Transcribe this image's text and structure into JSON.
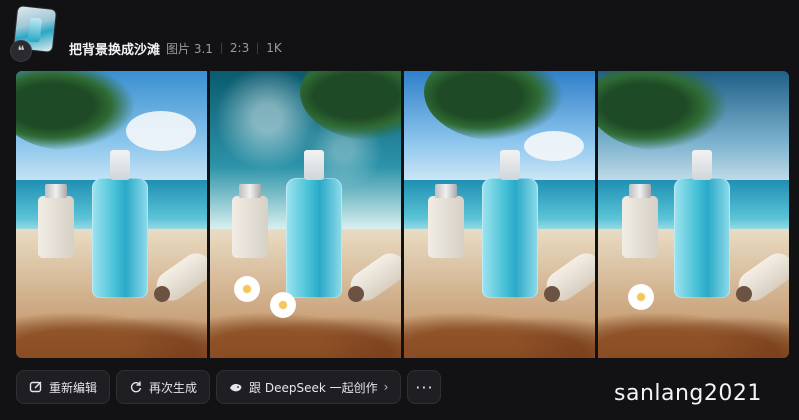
{
  "header": {
    "title": "把背景换成沙滩",
    "model": "图片 3.1",
    "ratio": "2:3",
    "resolution": "1K",
    "quote_icon": "quote-icon"
  },
  "images": [
    {
      "alt": "beach-product-1"
    },
    {
      "alt": "beach-product-2"
    },
    {
      "alt": "beach-product-3"
    },
    {
      "alt": "beach-product-4"
    }
  ],
  "actions": {
    "edit_label": "重新编辑",
    "regenerate_label": "再次生成",
    "deepseek_label": "跟 DeepSeek 一起创作",
    "more_label": "···",
    "edit_icon": "edit-icon",
    "regenerate_icon": "refresh-icon",
    "deepseek_icon": "deepseek-whale-icon"
  },
  "watermark": "sanlang2021"
}
